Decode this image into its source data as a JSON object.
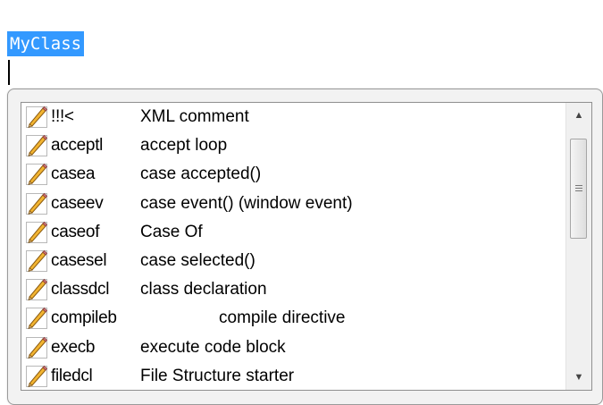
{
  "editor": {
    "selected_text": "MyClass"
  },
  "completion_list": {
    "items": [
      {
        "key": "!!!<",
        "description": "XML comment",
        "icon": "pencil-icon"
      },
      {
        "key": "acceptl",
        "description": "accept loop",
        "icon": "pencil-icon"
      },
      {
        "key": "casea",
        "description": "case accepted()",
        "icon": "pencil-icon"
      },
      {
        "key": "caseev",
        "description": "case event() (window event)",
        "icon": "pencil-icon"
      },
      {
        "key": "caseof",
        "description": "Case Of",
        "icon": "pencil-icon"
      },
      {
        "key": "casesel",
        "description": "case selected()",
        "icon": "pencil-icon"
      },
      {
        "key": "classdcl",
        "description": "class declaration",
        "icon": "pencil-icon"
      },
      {
        "key": "compileb",
        "description": "compile directive",
        "icon": "pencil-icon"
      },
      {
        "key": "execb",
        "description": "execute code block",
        "icon": "pencil-icon"
      },
      {
        "key": "filedcl",
        "description": "File Structure starter",
        "icon": "pencil-icon"
      }
    ],
    "scrollbar": {
      "up_arrow": "▲",
      "down_arrow": "▼"
    }
  },
  "colors": {
    "selection": "#3399ff",
    "popup_border": "#9a9a9a"
  }
}
